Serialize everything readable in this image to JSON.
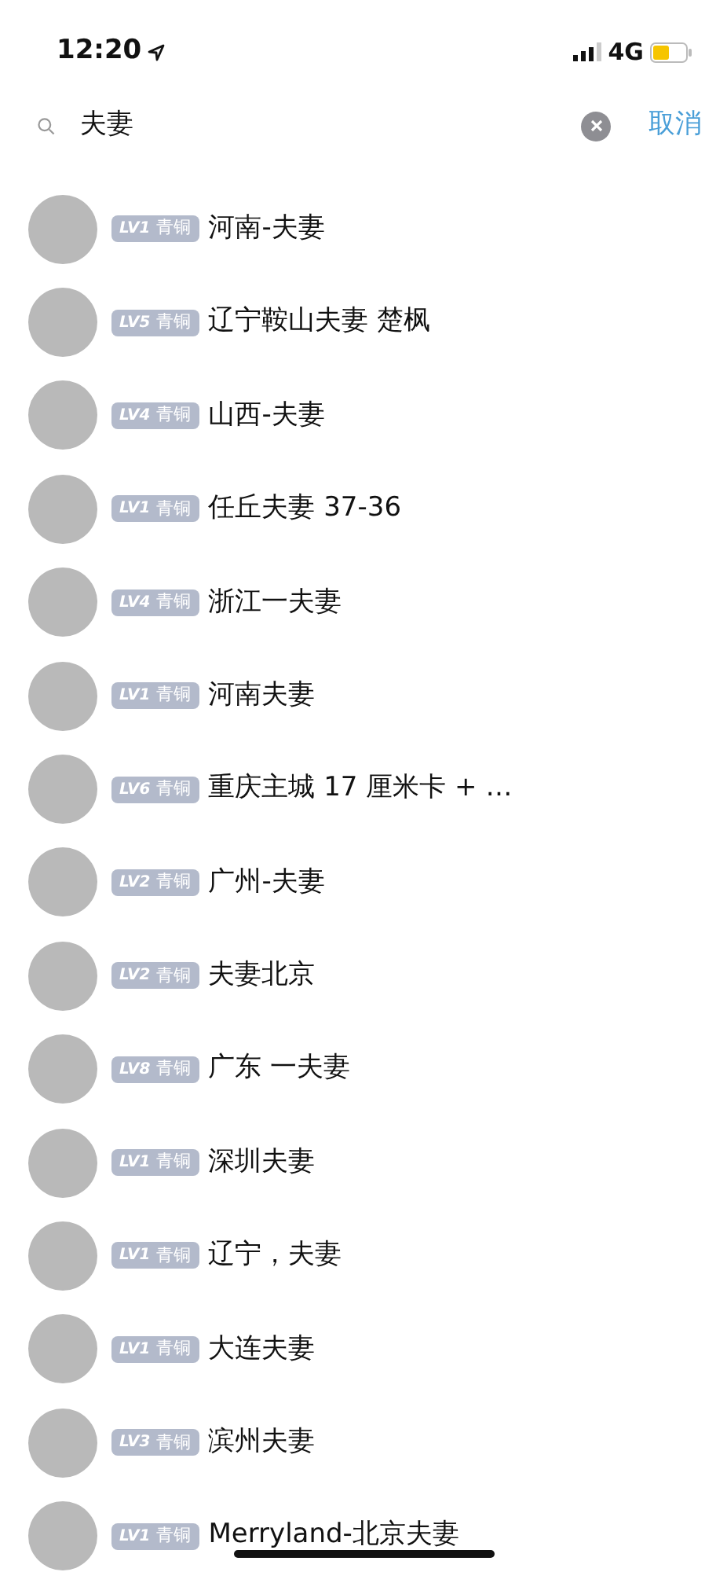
{
  "status_bar": {
    "time": "12:20",
    "network": "4G"
  },
  "search": {
    "value": "夫妻",
    "cancel": "取消"
  },
  "results": [
    {
      "level": "LV1",
      "rank": "青铜",
      "name": "河南-夫妻"
    },
    {
      "level": "LV5",
      "rank": "青铜",
      "name": "辽宁鞍山夫妻 楚枫"
    },
    {
      "level": "LV4",
      "rank": "青铜",
      "name": "山西-夫妻"
    },
    {
      "level": "LV1",
      "rank": "青铜",
      "name": "任丘夫妻 37-36"
    },
    {
      "level": "LV4",
      "rank": "青铜",
      "name": "浙江一夫妻"
    },
    {
      "level": "LV1",
      "rank": "青铜",
      "name": "河南夫妻"
    },
    {
      "level": "LV6",
      "rank": "青铜",
      "name": "重庆主城 17 厘米卡 + …"
    },
    {
      "level": "LV2",
      "rank": "青铜",
      "name": "广州-夫妻"
    },
    {
      "level": "LV2",
      "rank": "青铜",
      "name": "夫妻北京"
    },
    {
      "level": "LV8",
      "rank": "青铜",
      "name": "广东 一夫妻"
    },
    {
      "level": "LV1",
      "rank": "青铜",
      "name": "深圳夫妻"
    },
    {
      "level": "LV1",
      "rank": "青铜",
      "name": "辽宁，夫妻"
    },
    {
      "level": "LV1",
      "rank": "青铜",
      "name": "大连夫妻"
    },
    {
      "level": "LV3",
      "rank": "青铜",
      "name": "滨州夫妻"
    },
    {
      "level": "LV1",
      "rank": "青铜",
      "name": "Merryland-北京夫妻"
    }
  ]
}
